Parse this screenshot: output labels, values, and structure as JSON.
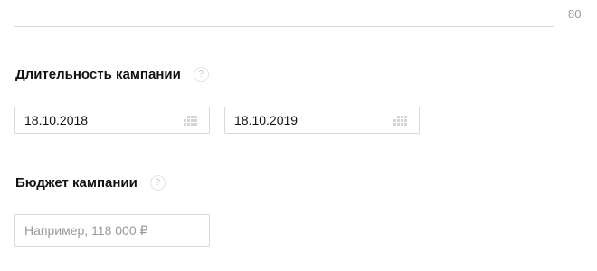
{
  "description": {
    "char_counter": "80"
  },
  "duration": {
    "title": "Длительность кампании",
    "help_symbol": "?",
    "start_date": "18.10.2018",
    "end_date": "18.10.2019",
    "calendar_icon": "calendar-icon"
  },
  "budget": {
    "title": "Бюджет кампании",
    "help_symbol": "?",
    "placeholder": "Например, 118 000 ₽",
    "value": ""
  }
}
